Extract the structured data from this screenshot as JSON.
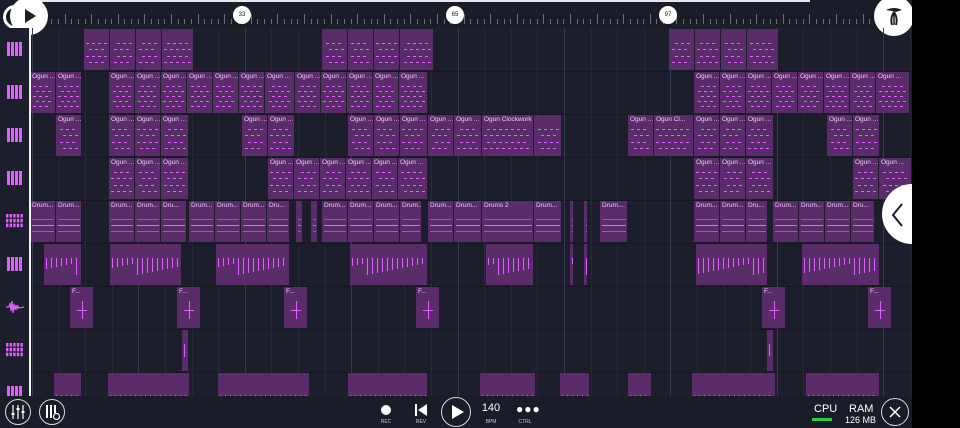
{
  "ruler": {
    "markers": [
      "33",
      "65",
      "97"
    ]
  },
  "tracks": [
    {
      "id": "t1",
      "icon": "piano-keys-icon",
      "clips": [
        {
          "start": 84,
          "end": 110,
          "label": ""
        },
        {
          "start": 110,
          "end": 136,
          "label": ""
        },
        {
          "start": 136,
          "end": 162,
          "label": ""
        },
        {
          "start": 162,
          "end": 194,
          "label": ""
        },
        {
          "start": 322,
          "end": 348,
          "label": ""
        },
        {
          "start": 348,
          "end": 374,
          "label": ""
        },
        {
          "start": 374,
          "end": 400,
          "label": ""
        },
        {
          "start": 400,
          "end": 434,
          "label": ""
        },
        {
          "start": 669,
          "end": 695,
          "label": ""
        },
        {
          "start": 695,
          "end": 721,
          "label": ""
        },
        {
          "start": 721,
          "end": 747,
          "label": ""
        },
        {
          "start": 747,
          "end": 779,
          "label": ""
        }
      ]
    },
    {
      "id": "t2",
      "icon": "piano-keys-icon",
      "clips": [
        {
          "start": 30,
          "end": 56,
          "label": "Ogun ..."
        },
        {
          "start": 56,
          "end": 82,
          "label": "Ogun ..."
        },
        {
          "start": 109,
          "end": 135,
          "label": "Ogun ..."
        },
        {
          "start": 135,
          "end": 161,
          "label": "Ogun ..."
        },
        {
          "start": 161,
          "end": 187,
          "label": "Ogun ..."
        },
        {
          "start": 187,
          "end": 213,
          "label": "Ogun ..."
        },
        {
          "start": 213,
          "end": 239,
          "label": "Ogun ..."
        },
        {
          "start": 239,
          "end": 265,
          "label": "Ogun ..."
        },
        {
          "start": 265,
          "end": 295,
          "label": "Ogun ..."
        },
        {
          "start": 295,
          "end": 321,
          "label": "Ogun ..."
        },
        {
          "start": 321,
          "end": 347,
          "label": "Ogun ..."
        },
        {
          "start": 347,
          "end": 373,
          "label": "Ogun ..."
        },
        {
          "start": 373,
          "end": 399,
          "label": "Ogun ..."
        },
        {
          "start": 399,
          "end": 428,
          "label": "Ogun ..."
        },
        {
          "start": 694,
          "end": 720,
          "label": "Ogun ..."
        },
        {
          "start": 720,
          "end": 746,
          "label": "Ogun ..."
        },
        {
          "start": 746,
          "end": 772,
          "label": "Ogun ..."
        },
        {
          "start": 772,
          "end": 798,
          "label": "Ogun ..."
        },
        {
          "start": 798,
          "end": 824,
          "label": "Ogun ..."
        },
        {
          "start": 824,
          "end": 850,
          "label": "Ogun ..."
        },
        {
          "start": 850,
          "end": 876,
          "label": "Ogun ..."
        },
        {
          "start": 876,
          "end": 910,
          "label": "Ogun ..."
        }
      ]
    },
    {
      "id": "t3",
      "icon": "piano-keys-icon",
      "clips": [
        {
          "start": 56,
          "end": 82,
          "label": "Ogun ..."
        },
        {
          "start": 109,
          "end": 135,
          "label": "Ogun ..."
        },
        {
          "start": 135,
          "end": 161,
          "label": "Ogun ..."
        },
        {
          "start": 161,
          "end": 189,
          "label": "Ogun ..."
        },
        {
          "start": 242,
          "end": 268,
          "label": "Ogun ..."
        },
        {
          "start": 268,
          "end": 295,
          "label": "Ogun ..."
        },
        {
          "start": 348,
          "end": 374,
          "label": "Ogun ..."
        },
        {
          "start": 374,
          "end": 400,
          "label": "Ogun ..."
        },
        {
          "start": 400,
          "end": 428,
          "label": "Ogun ..."
        },
        {
          "start": 428,
          "end": 454,
          "label": "Ogun ..."
        },
        {
          "start": 454,
          "end": 482,
          "label": "Ogun ..."
        },
        {
          "start": 482,
          "end": 534,
          "label": "Ogun Clockwork"
        },
        {
          "start": 534,
          "end": 562,
          "label": ""
        },
        {
          "start": 628,
          "end": 654,
          "label": "Ogun ..."
        },
        {
          "start": 654,
          "end": 694,
          "label": "Ogun Cl..."
        },
        {
          "start": 694,
          "end": 720,
          "label": "Ogun ..."
        },
        {
          "start": 720,
          "end": 746,
          "label": "Ogun ..."
        },
        {
          "start": 746,
          "end": 774,
          "label": "Ogun ..."
        },
        {
          "start": 827,
          "end": 853,
          "label": "Ogun ..."
        },
        {
          "start": 853,
          "end": 880,
          "label": "Ogun ..."
        }
      ]
    },
    {
      "id": "t4",
      "icon": "piano-keys-icon",
      "clips": [
        {
          "start": 109,
          "end": 135,
          "label": "Ogun ..."
        },
        {
          "start": 135,
          "end": 161,
          "label": "Ogun ..."
        },
        {
          "start": 161,
          "end": 189,
          "label": "Ogun ..."
        },
        {
          "start": 268,
          "end": 294,
          "label": "Ogun ..."
        },
        {
          "start": 294,
          "end": 320,
          "label": "Ogun ..."
        },
        {
          "start": 320,
          "end": 346,
          "label": "Ogun ..."
        },
        {
          "start": 346,
          "end": 372,
          "label": "Ogun ..."
        },
        {
          "start": 372,
          "end": 398,
          "label": "Ogun ..."
        },
        {
          "start": 398,
          "end": 428,
          "label": "Ogun ..."
        },
        {
          "start": 694,
          "end": 720,
          "label": "Ogun ..."
        },
        {
          "start": 720,
          "end": 746,
          "label": "Ogun ..."
        },
        {
          "start": 746,
          "end": 774,
          "label": "Ogun ..."
        },
        {
          "start": 853,
          "end": 879,
          "label": "Ogun ..."
        },
        {
          "start": 879,
          "end": 912,
          "label": "Ogun ..."
        }
      ]
    },
    {
      "id": "t5",
      "icon": "drum-pads-icon",
      "clips": [
        {
          "start": 30,
          "end": 56,
          "label": "Drum..."
        },
        {
          "start": 56,
          "end": 82,
          "label": "Drum..."
        },
        {
          "start": 109,
          "end": 135,
          "label": "Drum..."
        },
        {
          "start": 135,
          "end": 161,
          "label": "Drum..."
        },
        {
          "start": 161,
          "end": 187,
          "label": "Dru..."
        },
        {
          "start": 189,
          "end": 215,
          "label": "Drum..."
        },
        {
          "start": 215,
          "end": 241,
          "label": "Drum..."
        },
        {
          "start": 241,
          "end": 267,
          "label": "Drum..."
        },
        {
          "start": 267,
          "end": 290,
          "label": "Dru..."
        },
        {
          "start": 296,
          "end": 303,
          "label": ""
        },
        {
          "start": 311,
          "end": 318,
          "label": ""
        },
        {
          "start": 322,
          "end": 348,
          "label": "Drum..."
        },
        {
          "start": 348,
          "end": 374,
          "label": "Drum..."
        },
        {
          "start": 374,
          "end": 400,
          "label": "Drum..."
        },
        {
          "start": 400,
          "end": 422,
          "label": "Drum..."
        },
        {
          "start": 428,
          "end": 454,
          "label": "Drum..."
        },
        {
          "start": 454,
          "end": 482,
          "label": "Drum..."
        },
        {
          "start": 482,
          "end": 534,
          "label": "Drums 2"
        },
        {
          "start": 534,
          "end": 562,
          "label": "Drum..."
        },
        {
          "start": 570,
          "end": 574,
          "label": ""
        },
        {
          "start": 584,
          "end": 588,
          "label": ""
        },
        {
          "start": 600,
          "end": 628,
          "label": "Drum..."
        },
        {
          "start": 694,
          "end": 720,
          "label": "Drum..."
        },
        {
          "start": 720,
          "end": 746,
          "label": "Drum..."
        },
        {
          "start": 746,
          "end": 768,
          "label": "Dru..."
        },
        {
          "start": 773,
          "end": 799,
          "label": "Drum..."
        },
        {
          "start": 799,
          "end": 825,
          "label": "Drum..."
        },
        {
          "start": 825,
          "end": 851,
          "label": "Drum..."
        },
        {
          "start": 851,
          "end": 875,
          "label": "Dru..."
        }
      ]
    },
    {
      "id": "t6",
      "icon": "piano-keys-icon",
      "clips": [
        {
          "start": 44,
          "end": 82,
          "label": ""
        },
        {
          "start": 110,
          "end": 182,
          "label": ""
        },
        {
          "start": 216,
          "end": 290,
          "label": ""
        },
        {
          "start": 350,
          "end": 428,
          "label": ""
        },
        {
          "start": 486,
          "end": 534,
          "label": ""
        },
        {
          "start": 570,
          "end": 574,
          "label": ""
        },
        {
          "start": 584,
          "end": 588,
          "label": ""
        },
        {
          "start": 696,
          "end": 768,
          "label": ""
        },
        {
          "start": 802,
          "end": 880,
          "label": ""
        }
      ]
    },
    {
      "id": "t7",
      "icon": "waveform-icon",
      "clips": [
        {
          "start": 70,
          "end": 94,
          "label": "F..."
        },
        {
          "start": 177,
          "end": 201,
          "label": "F..."
        },
        {
          "start": 284,
          "end": 308,
          "label": "F..."
        },
        {
          "start": 416,
          "end": 440,
          "label": "F..."
        },
        {
          "start": 762,
          "end": 786,
          "label": "F..."
        },
        {
          "start": 868,
          "end": 892,
          "label": "F..."
        }
      ]
    },
    {
      "id": "t8",
      "icon": "drum-pads-icon",
      "clips": [
        {
          "start": 182,
          "end": 189,
          "label": ""
        },
        {
          "start": 767,
          "end": 774,
          "label": ""
        }
      ]
    },
    {
      "id": "t9",
      "icon": "piano-keys-icon",
      "clips": [
        {
          "start": 54,
          "end": 82,
          "label": ""
        },
        {
          "start": 108,
          "end": 190,
          "label": ""
        },
        {
          "start": 218,
          "end": 310,
          "label": ""
        },
        {
          "start": 348,
          "end": 428,
          "label": ""
        },
        {
          "start": 480,
          "end": 536,
          "label": ""
        },
        {
          "start": 560,
          "end": 590,
          "label": ""
        },
        {
          "start": 628,
          "end": 652,
          "label": ""
        },
        {
          "start": 692,
          "end": 776,
          "label": ""
        },
        {
          "start": 806,
          "end": 880,
          "label": ""
        }
      ]
    }
  ],
  "transport": {
    "rec_label": "REC",
    "rev_label": "REV",
    "bpm_value": "140",
    "bpm_label": "BPM",
    "ctrl_label": "CTRL",
    "cpu_label": "CPU",
    "ram_label": "RAM",
    "ram_value": "126 MB"
  },
  "colors": {
    "accent": "#e060ff",
    "clip": "#5a2d6a",
    "background": "#1c1e2b",
    "cpu_meter": "#2bd13c"
  }
}
